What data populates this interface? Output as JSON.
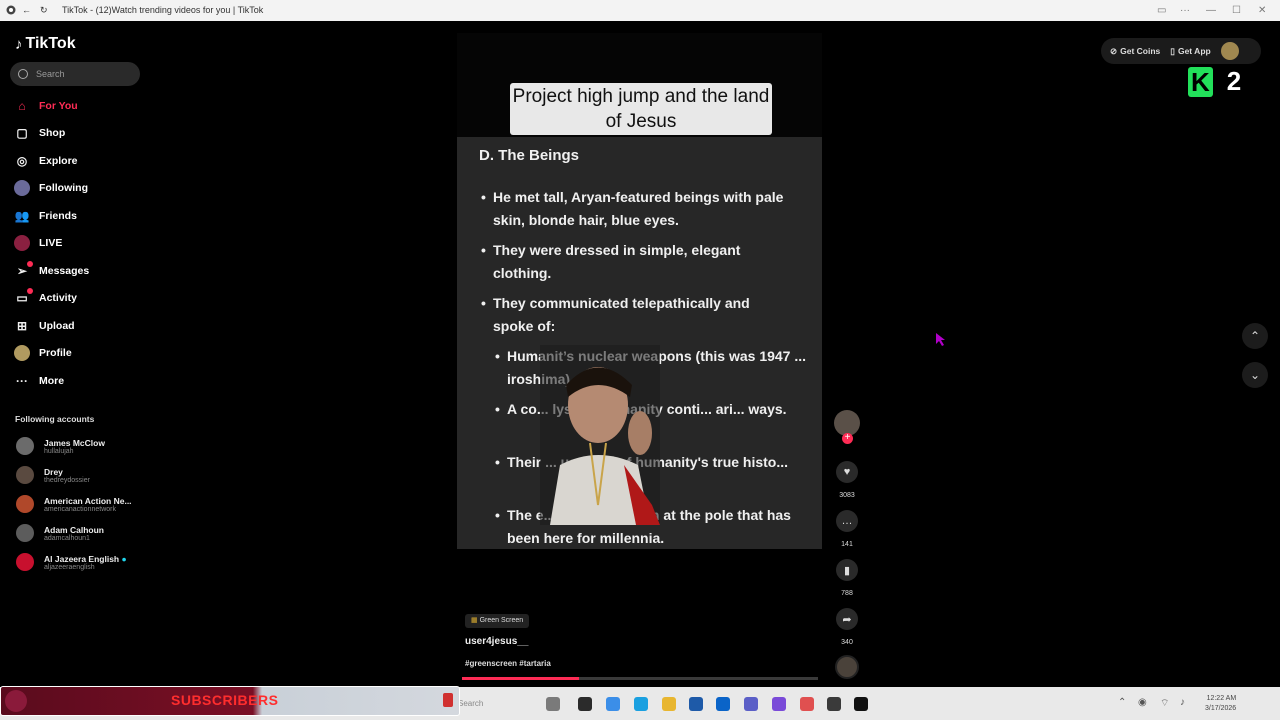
{
  "browser": {
    "tab_title": "TikTok - (12)Watch trending videos for you | TikTok",
    "menu": "···"
  },
  "sidebar": {
    "logo": "TikTok",
    "search_placeholder": "Search",
    "nav": [
      {
        "label": "For You",
        "icon": "home-icon",
        "active": true
      },
      {
        "label": "Shop",
        "icon": "shopping-bag-icon"
      },
      {
        "label": "Explore",
        "icon": "compass-icon"
      },
      {
        "label": "Following",
        "icon": "following-avatar-icon"
      },
      {
        "label": "Friends",
        "icon": "friends-icon"
      },
      {
        "label": "LIVE",
        "icon": "live-icon"
      },
      {
        "label": "Messages",
        "icon": "send-icon"
      },
      {
        "label": "Activity",
        "icon": "activity-icon"
      },
      {
        "label": "Upload",
        "icon": "plus-square-icon"
      },
      {
        "label": "Profile",
        "icon": "profile-avatar-icon"
      },
      {
        "label": "More",
        "icon": "ellipsis-icon"
      }
    ],
    "following_heading": "Following accounts",
    "accounts": [
      {
        "name": "James McClow",
        "handle": "hullalujah",
        "color": "#6b6b6b"
      },
      {
        "name": "Drey",
        "handle": "thedreydossier",
        "color": "#5a4a40"
      },
      {
        "name": "American Action Ne...",
        "handle": "americanactionnetwork",
        "color": "#b0482a"
      },
      {
        "name": "Adam Calhoun",
        "handle": "adamcalhoun1",
        "color": "#5c5c5c"
      },
      {
        "name": "Al Jazeera English",
        "handle": "aljazeeraenglish",
        "color": "#c8102e",
        "verified": true
      }
    ]
  },
  "header": {
    "get_coins": "Get Coins",
    "get_app": "Get App"
  },
  "overlay_badge": {
    "letter": "K",
    "number": "2",
    "color": "#22e05a"
  },
  "video": {
    "caption": "Project high jump and the land of Jesus",
    "slide_heading": "D. The Beings",
    "bullets": [
      {
        "text": "He met tall, Aryan-featured beings with pale skin, blonde hair, blue eyes.",
        "level": 1
      },
      {
        "text": "They were dressed in simple, elegant clothing.",
        "level": 1
      },
      {
        "text": "They communicated telepathically and spoke of:",
        "level": 1
      },
      {
        "text": "Humanit’s nuclear weapons (this was 1947 ... iroshima).",
        "level": 2
      },
      {
        "text": "A co... lysm if humanity conti... ari... ways.",
        "level": 2
      },
      {
        "text": "Their ... uard... s of humanity's true histo...",
        "level": 2
      },
      {
        "text": "The e... den civilization at the pole that has been here for millennia.",
        "level": 2
      }
    ],
    "effect_tag": "Green Screen",
    "username": "user4jesus__",
    "hashtags": "#greenscreen #tartaria",
    "progress": 0.33
  },
  "actions": {
    "likes": "3083",
    "comments": "141",
    "saves": "788",
    "shares": "340"
  },
  "stream_overlay": {
    "label": "SUBSCRIBERS"
  },
  "taskbar": {
    "search_placeholder": "Search",
    "time": "12:22 AM",
    "date": "3/17/2026"
  }
}
